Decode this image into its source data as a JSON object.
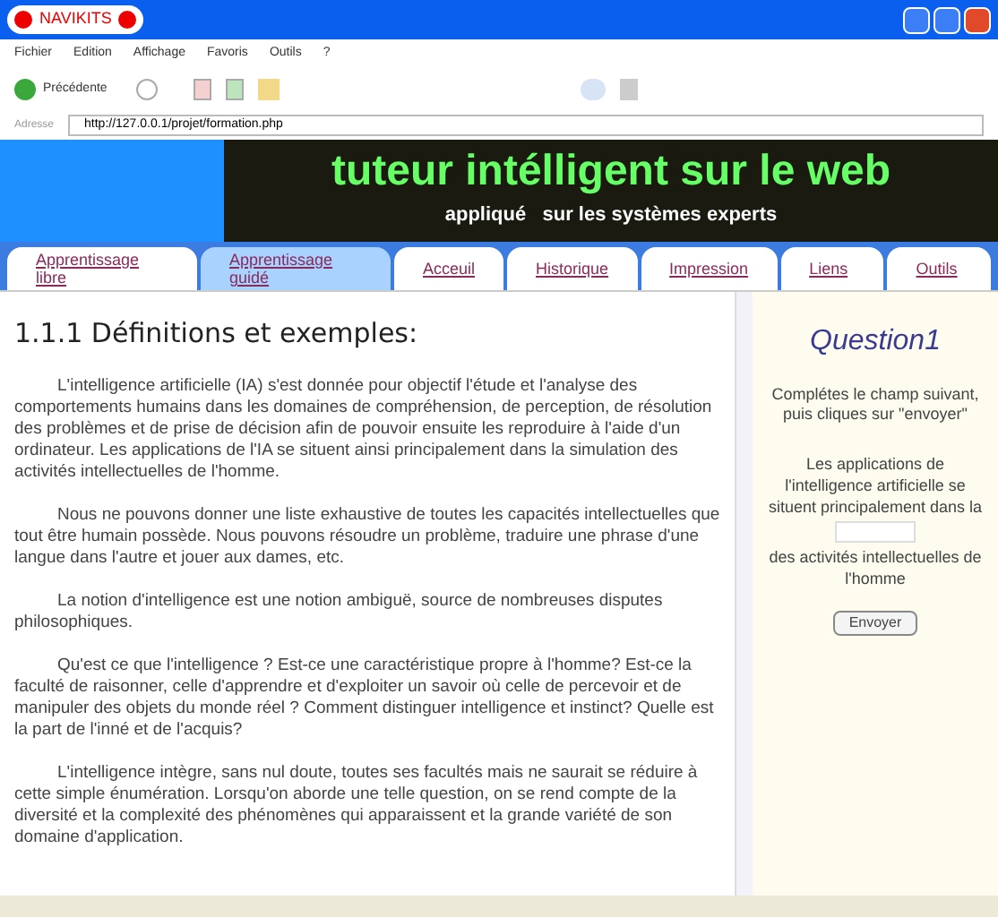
{
  "window": {
    "title": "NAVIKITS"
  },
  "menu": [
    "Fichier",
    "Edition",
    "Affichage",
    "Favoris",
    "Outils",
    "?"
  ],
  "toolbar": {
    "back_label": "Précédente"
  },
  "address": {
    "label": "Adresse",
    "value": "http://127.0.0.1/projet/formation.php"
  },
  "banner": {
    "title": "tuteur intélligent sur le web",
    "subtitle": "appliqué   sur les systèmes experts"
  },
  "tabs": [
    {
      "label": "Apprentissage libre",
      "selected": false
    },
    {
      "label": "Apprentissage guidé",
      "selected": true
    },
    {
      "label": "Acceuil",
      "selected": false
    },
    {
      "label": "Historique",
      "selected": false
    },
    {
      "label": "Impression",
      "selected": false
    },
    {
      "label": "Liens",
      "selected": false
    },
    {
      "label": "Outils",
      "selected": false
    }
  ],
  "content": {
    "heading": "1.1.1 Définitions et exemples:",
    "paragraphs": [
      "L'intelligence artificielle (IA) s'est donnée pour objectif l'étude et l'analyse des comportements humains dans les domaines de compréhension, de perception, de résolution des problèmes et de prise de décision afin de pouvoir ensuite les reproduire à l'aide d'un ordinateur. Les applications de l'IA se situent ainsi principalement dans la simulation des activités intellectuelles de l'homme.",
      "Nous ne pouvons donner une liste exhaustive de toutes les capacités intellectuelles que tout être humain possède. Nous pouvons résoudre un problème, traduire une phrase d'une langue dans l'autre et jouer aux dames, etc.",
      "La notion d'intelligence est une notion ambiguë, source de nombreuses disputes philosophiques.",
      "Qu'est ce que l'intelligence ? Est-ce une caractéristique propre à l'homme? Est-ce la faculté de raisonner, celle d'apprendre et d'exploiter un savoir où celle de percevoir et de manipuler des objets du monde réel ? Comment distinguer intelligence et instinct? Quelle est la part de l'inné et de l'acquis?",
      "L'intelligence intègre, sans nul doute, toutes ses facultés mais ne saurait se réduire à cette simple énumération. Lorsqu'on aborde une telle question, on se rend compte de la diversité et la complexité des phénomènes qui apparaissent et la grande variété de son domaine d'application."
    ]
  },
  "question": {
    "title": "Question1",
    "instruction": "Complétes le champ suivant, puis cliques sur \"envoyer\"",
    "text_before": "Les applications de l'intelligence artificielle se situent principalement dans la",
    "text_after": "des activités intellectuelles de l'homme",
    "button": "Envoyer"
  }
}
